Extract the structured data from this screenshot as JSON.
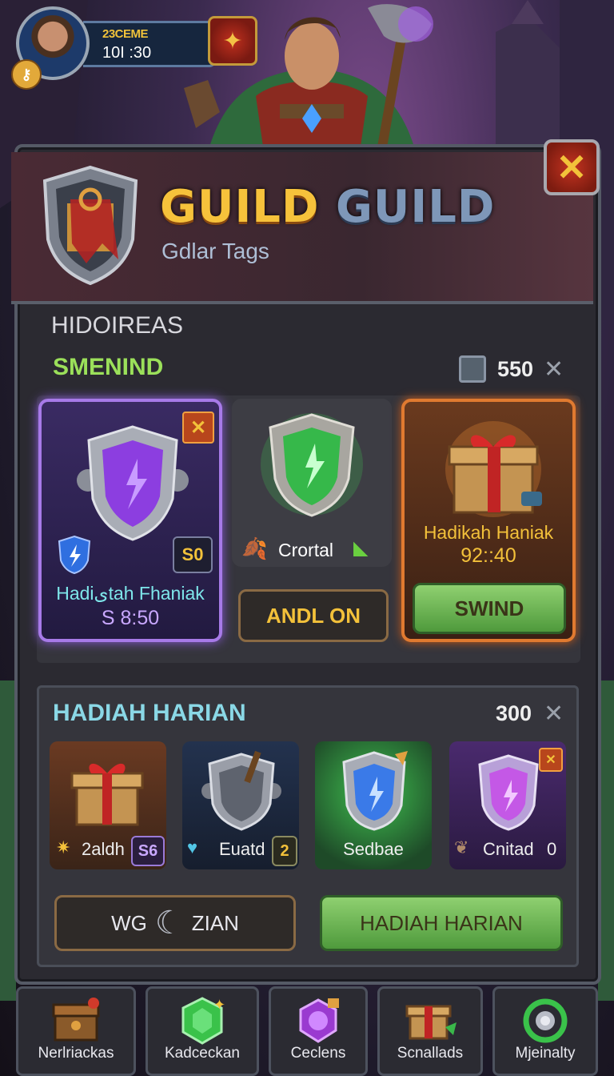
{
  "hud": {
    "player_name": "23CEME",
    "time": "10I :30",
    "badge_icon": "key-icon",
    "emblem_icon": "crest-icon"
  },
  "banner": {
    "title_part1": "GUILD",
    "title_part2": "GUILD",
    "subtitle": "Gdlar Tags"
  },
  "section1": {
    "title": "HIDOIREAS",
    "subtitle": "SMENIND",
    "count": "550",
    "cards": [
      {
        "name": "Hadiیtah Fhaniak",
        "timer": "S 8:50",
        "badge": "S0"
      },
      {
        "name": "Crortal",
        "button": "ANDL ON"
      },
      {
        "name": "Hadikah Haniak",
        "timer": "92::40",
        "button": "SWIND"
      }
    ]
  },
  "section2": {
    "title": "HADIAH HARIAN",
    "count": "300",
    "tiles": [
      {
        "label": "2aldh",
        "badge": "S6"
      },
      {
        "label": "Euatd",
        "badge": "2"
      },
      {
        "label": "Sedbae"
      },
      {
        "label": "Cnitad",
        "badge": "0"
      }
    ],
    "btn_left_part1": "WG",
    "btn_left_part2": "ZIAN",
    "btn_right": "HADIAH HARIAN"
  },
  "nav": [
    {
      "label": "Nerlriackas",
      "icon": "treasure-chest-icon"
    },
    {
      "label": "Kadceckan",
      "icon": "emerald-gem-icon"
    },
    {
      "label": "Ceclens",
      "icon": "purple-gem-icon"
    },
    {
      "label": "Scnallads",
      "icon": "gift-box-icon"
    },
    {
      "label": "Mjeinalty",
      "icon": "emerald-ring-icon"
    }
  ]
}
